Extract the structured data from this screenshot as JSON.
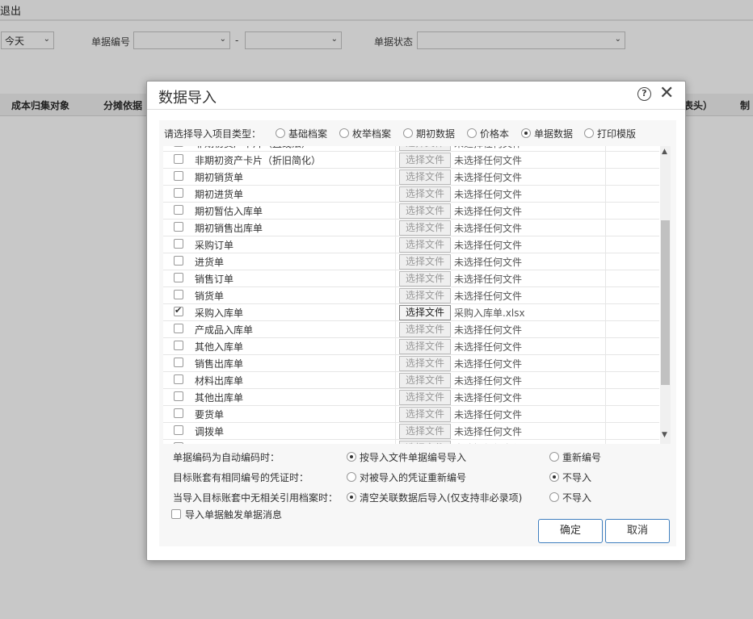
{
  "background": {
    "exit_label": "退出",
    "date_select": "今天",
    "doc_no_label": "单据编号",
    "range_sep": "-",
    "doc_status_label": "单据状态",
    "columns": [
      "成本归集对象",
      "分摊依据",
      "表头）",
      "制"
    ]
  },
  "dialog": {
    "title": "数据导入",
    "help_icon": "?",
    "close_icon": "✕",
    "type_prompt": "请选择导入项目类型：",
    "types": [
      {
        "label": "基础档案",
        "selected": false
      },
      {
        "label": "枚举档案",
        "selected": false
      },
      {
        "label": "期初数据",
        "selected": false
      },
      {
        "label": "价格本",
        "selected": false
      },
      {
        "label": "单据数据",
        "selected": true
      },
      {
        "label": "打印模版",
        "selected": false
      }
    ],
    "choose_file_label": "选择文件",
    "no_file_text": "未选择任何文件",
    "rows": [
      {
        "name": "非期初资产卡片（直线法）",
        "checked": false,
        "file": "未选择任何文件"
      },
      {
        "name": "非期初资产卡片（折旧简化）",
        "checked": false,
        "file": "未选择任何文件"
      },
      {
        "name": "期初销货单",
        "checked": false,
        "file": "未选择任何文件"
      },
      {
        "name": "期初进货单",
        "checked": false,
        "file": "未选择任何文件"
      },
      {
        "name": "期初暂估入库单",
        "checked": false,
        "file": "未选择任何文件"
      },
      {
        "name": "期初销售出库单",
        "checked": false,
        "file": "未选择任何文件"
      },
      {
        "name": "采购订单",
        "checked": false,
        "file": "未选择任何文件"
      },
      {
        "name": "进货单",
        "checked": false,
        "file": "未选择任何文件"
      },
      {
        "name": "销售订单",
        "checked": false,
        "file": "未选择任何文件"
      },
      {
        "name": "销货单",
        "checked": false,
        "file": "未选择任何文件"
      },
      {
        "name": "采购入库单",
        "checked": true,
        "file": "采购入库单.xlsx"
      },
      {
        "name": "产成品入库单",
        "checked": false,
        "file": "未选择任何文件"
      },
      {
        "name": "其他入库单",
        "checked": false,
        "file": "未选择任何文件"
      },
      {
        "name": "销售出库单",
        "checked": false,
        "file": "未选择任何文件"
      },
      {
        "name": "材料出库单",
        "checked": false,
        "file": "未选择任何文件"
      },
      {
        "name": "其他出库单",
        "checked": false,
        "file": "未选择任何文件"
      },
      {
        "name": "要货单",
        "checked": false,
        "file": "未选择任何文件"
      },
      {
        "name": "调拨单",
        "checked": false,
        "file": "未选择任何文件"
      },
      {
        "name": "",
        "checked": false,
        "file": "未选择任何文件"
      }
    ],
    "options": [
      {
        "label": "单据编码为自动编码时：",
        "opt1": "按导入文件单据编号导入",
        "opt1_selected": true,
        "opt2": "重新编号",
        "opt2_selected": false
      },
      {
        "label": "目标账套有相同编号的凭证时：",
        "opt1": "对被导入的凭证重新编号",
        "opt1_selected": false,
        "opt2": "不导入",
        "opt2_selected": true
      },
      {
        "label": "当导入目标账套中无相关引用档案时：",
        "opt1": "清空关联数据后导入(仅支持非必录项)",
        "opt1_selected": true,
        "opt2": "不导入",
        "opt2_selected": false
      }
    ],
    "trigger_label": "导入单据触发单据消息",
    "confirm_label": "确定",
    "cancel_label": "取消"
  }
}
